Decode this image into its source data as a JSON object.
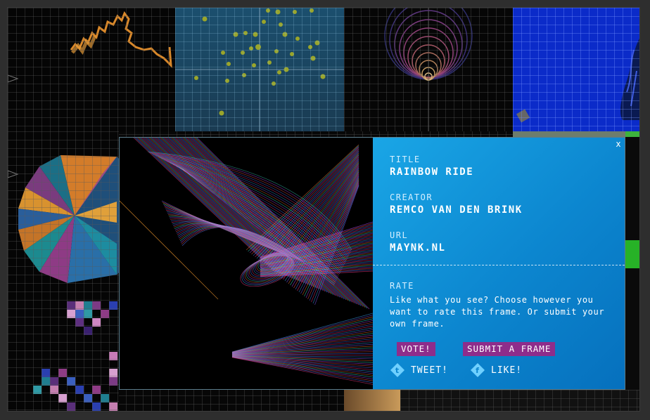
{
  "gallery": {
    "tiles": [
      {
        "name": "squiggle-tile"
      },
      {
        "name": "dots-tile"
      },
      {
        "name": "circles-tile"
      },
      {
        "name": "blue-tile"
      },
      {
        "name": "pie-tile"
      },
      {
        "name": "pixels-tile"
      }
    ]
  },
  "modal": {
    "close_glyph": "x",
    "title_label": "TITLE",
    "title_value": "RAINBOW RIDE",
    "creator_label": "CREATOR",
    "creator_value": "REMCO VAN DEN BRINK",
    "url_label": "URL",
    "url_value": "MAYNK.NL",
    "rate_label": "RATE",
    "rate_text": "Like what you see? Choose however you want to rate this frame. Or submit your own frame.",
    "vote_label": "VOTE!",
    "submit_label": "SUBMIT A FRAME",
    "tweet_label": "TWEET!",
    "like_label": "LIKE!"
  },
  "colors": {
    "panel_blue": "#0c86cf",
    "button_purple": "#8e2d8b",
    "accent_white": "#ffffff"
  }
}
